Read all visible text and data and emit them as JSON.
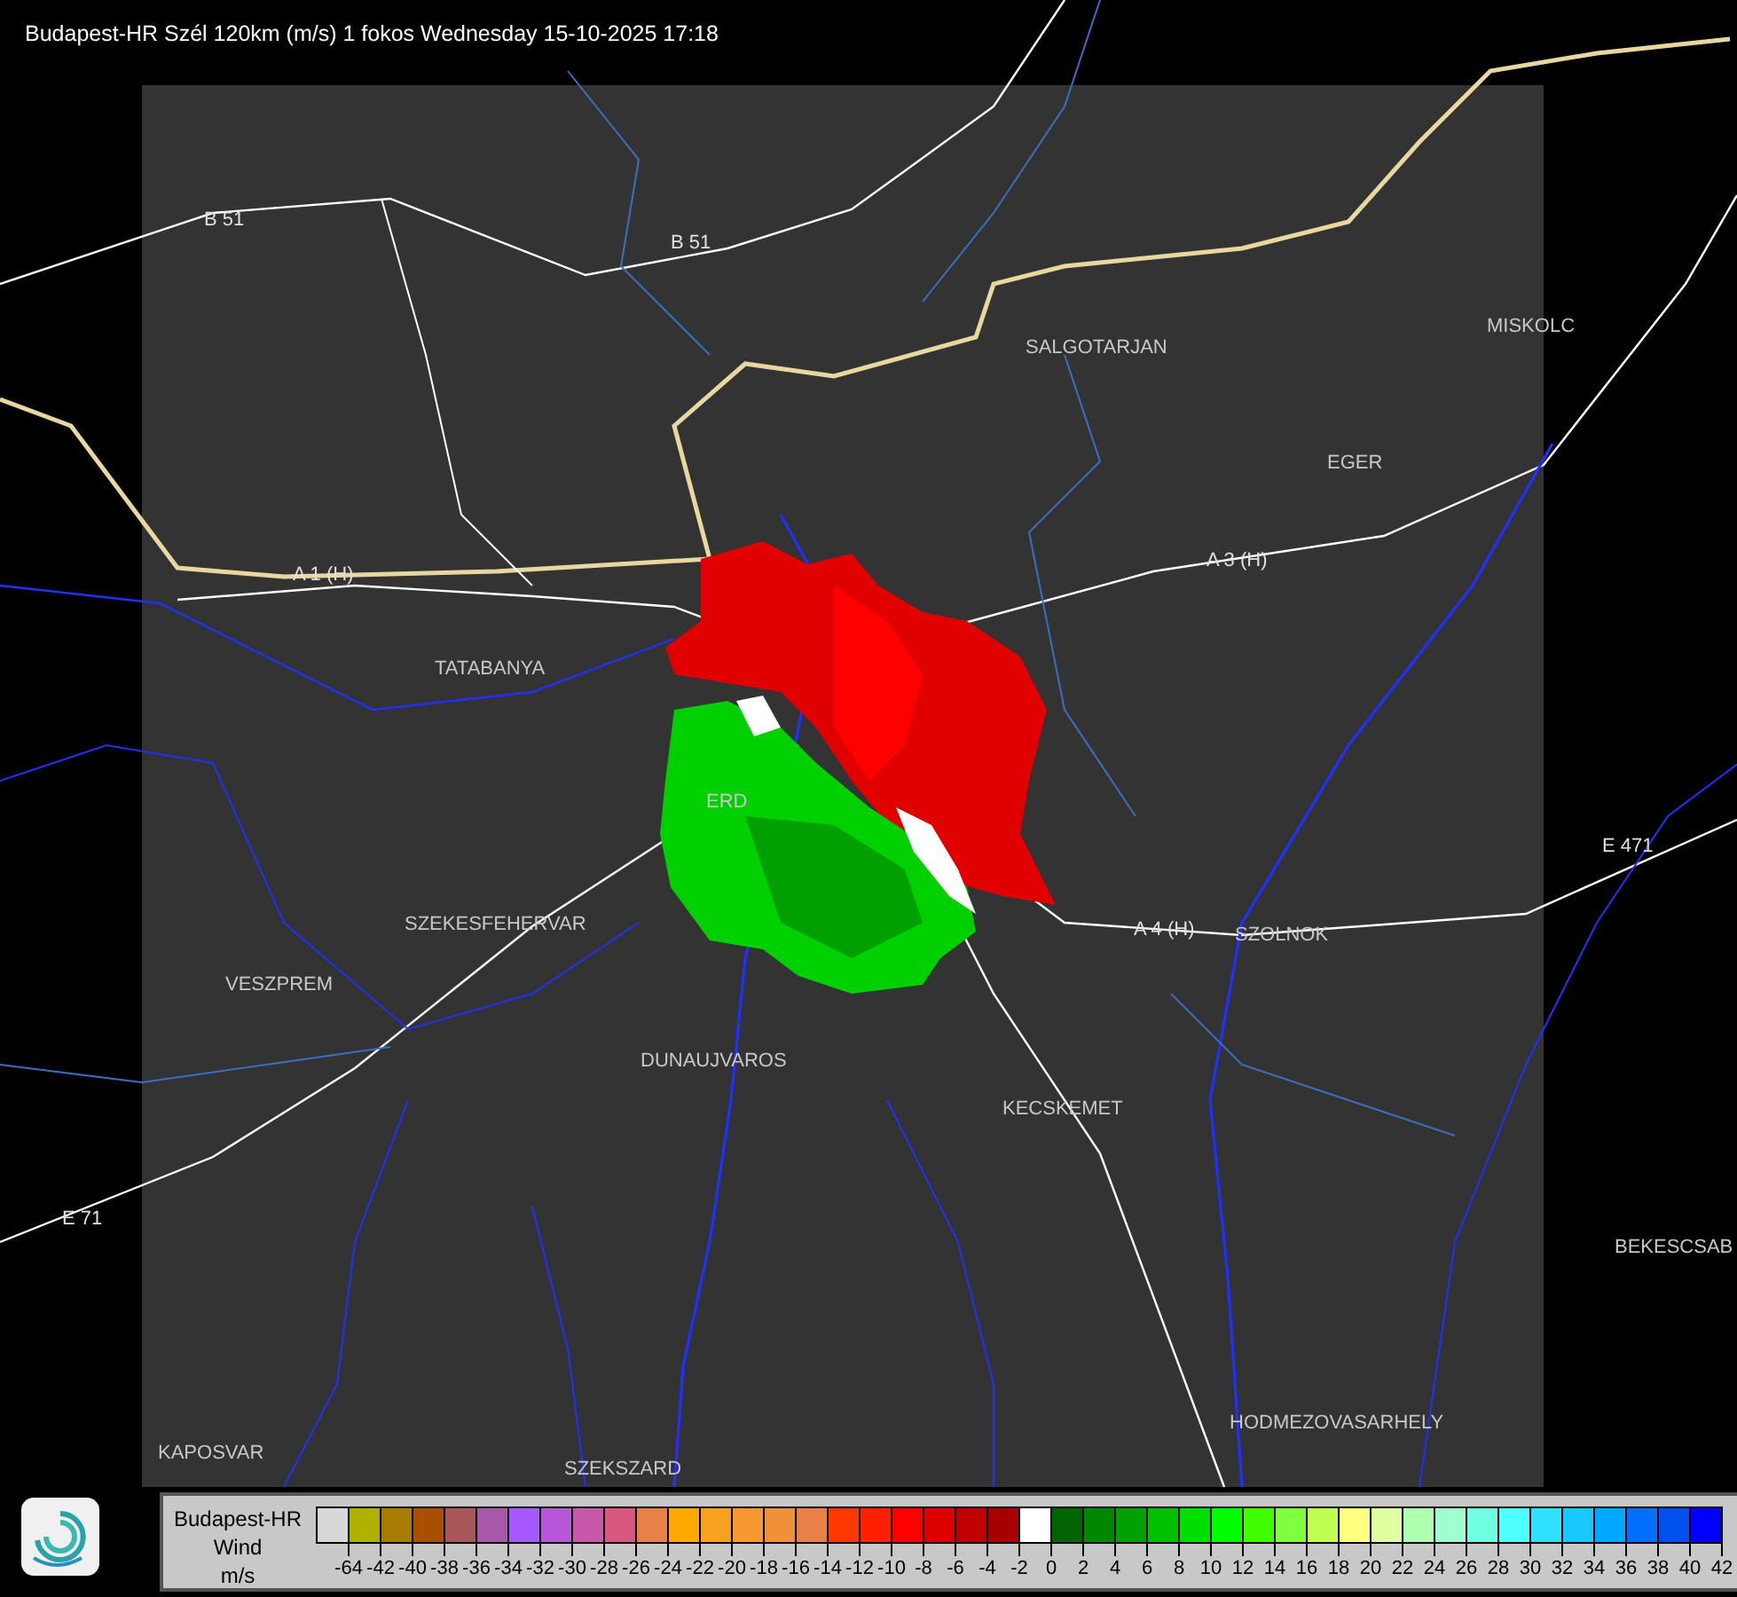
{
  "title": "Budapest-HR Szél 120km (m/s) 1 fokos Wednesday 15-10-2025 17:18",
  "map": {
    "labels": [
      {
        "text": "B 51",
        "kind": "road"
      },
      {
        "text": "B 51",
        "kind": "road"
      },
      {
        "text": "SALGOTARJAN",
        "kind": "city"
      },
      {
        "text": "MISKOLC",
        "kind": "city"
      },
      {
        "text": "EGER",
        "kind": "city"
      },
      {
        "text": "A 3 (H)",
        "kind": "road"
      },
      {
        "text": "A 1 (H)",
        "kind": "road"
      },
      {
        "text": "TATABANYA",
        "kind": "city"
      },
      {
        "text": "ERD",
        "kind": "city"
      },
      {
        "text": "SZEKESFEHERVAR",
        "kind": "city"
      },
      {
        "text": "VESZPREM",
        "kind": "city"
      },
      {
        "text": "A 4 (H)",
        "kind": "road"
      },
      {
        "text": "SZOLNOK",
        "kind": "city"
      },
      {
        "text": "E 471",
        "kind": "road"
      },
      {
        "text": "DUNAUJVAROS",
        "kind": "city"
      },
      {
        "text": "KECSKEMET",
        "kind": "city"
      },
      {
        "text": "E 71",
        "kind": "road"
      },
      {
        "text": "BEKESCSAB",
        "kind": "city"
      },
      {
        "text": "HODMEZOVASARHELY",
        "kind": "city"
      },
      {
        "text": "KAPOSVAR",
        "kind": "city"
      },
      {
        "text": "SZEKSZARD",
        "kind": "city"
      }
    ]
  },
  "legend": {
    "title_lines": [
      "Budapest-HR",
      "Wind",
      "m/s"
    ],
    "scale": [
      {
        "label": "-64",
        "color": "#d8d8d8"
      },
      {
        "label": "-42",
        "color": "#b0b000"
      },
      {
        "label": "-40",
        "color": "#a87c00"
      },
      {
        "label": "-38",
        "color": "#a85000"
      },
      {
        "label": "-36",
        "color": "#a85858"
      },
      {
        "label": "-34",
        "color": "#a858a8"
      },
      {
        "label": "-32",
        "color": "#a858ff"
      },
      {
        "label": "-30",
        "color": "#b858d8"
      },
      {
        "label": "-28",
        "color": "#c858a8"
      },
      {
        "label": "-26",
        "color": "#d85880"
      },
      {
        "label": "-24",
        "color": "#e88048"
      },
      {
        "label": "-22",
        "color": "#ffa800"
      },
      {
        "label": "-20",
        "color": "#f8a020"
      },
      {
        "label": "-18",
        "color": "#f89830"
      },
      {
        "label": "-16",
        "color": "#f09038"
      },
      {
        "label": "-14",
        "color": "#e88048"
      },
      {
        "label": "-12",
        "color": "#ff3800"
      },
      {
        "label": "-10",
        "color": "#ff2000"
      },
      {
        "label": "-8",
        "color": "#ff0000"
      },
      {
        "label": "-6",
        "color": "#e00000"
      },
      {
        "label": "-4",
        "color": "#c00000"
      },
      {
        "label": "-2",
        "color": "#a80000"
      },
      {
        "label": "0",
        "color": "#ffffff"
      },
      {
        "label": "2",
        "color": "#006400"
      },
      {
        "label": "4",
        "color": "#008800"
      },
      {
        "label": "6",
        "color": "#00a000"
      },
      {
        "label": "8",
        "color": "#00c000"
      },
      {
        "label": "10",
        "color": "#00e000"
      },
      {
        "label": "12",
        "color": "#00ff00"
      },
      {
        "label": "14",
        "color": "#40ff00"
      },
      {
        "label": "16",
        "color": "#80ff40"
      },
      {
        "label": "18",
        "color": "#c0ff50"
      },
      {
        "label": "20",
        "color": "#ffff80"
      },
      {
        "label": "22",
        "color": "#e0ffa0"
      },
      {
        "label": "24",
        "color": "#b0ffb0"
      },
      {
        "label": "26",
        "color": "#a0ffd0"
      },
      {
        "label": "28",
        "color": "#70ffe0"
      },
      {
        "label": "30",
        "color": "#50ffff"
      },
      {
        "label": "32",
        "color": "#30e0ff"
      },
      {
        "label": "34",
        "color": "#18c8ff"
      },
      {
        "label": "36",
        "color": "#00a8ff"
      },
      {
        "label": "38",
        "color": "#0070ff"
      },
      {
        "label": "40",
        "color": "#0050f0"
      },
      {
        "label": "42",
        "color": "#0000ff"
      }
    ]
  }
}
